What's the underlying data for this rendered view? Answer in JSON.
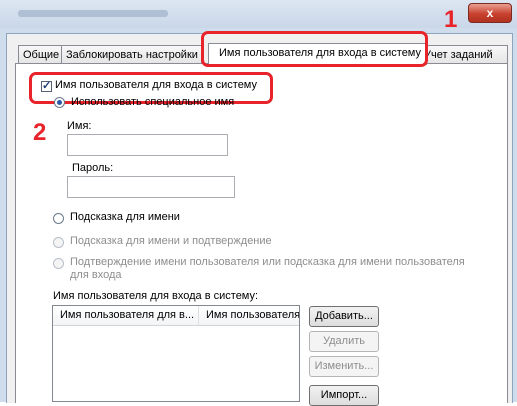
{
  "window": {
    "close_glyph": "x"
  },
  "tabs": [
    {
      "label": "Общие"
    },
    {
      "label": "Заблокировать настройки"
    },
    {
      "label": "Имя пользователя для входа в систему"
    },
    {
      "label": "Учет заданий"
    }
  ],
  "callouts": {
    "one": "1",
    "two": "2"
  },
  "login_checkbox": {
    "label": "Имя пользователя для входа в систему",
    "checked": true
  },
  "option_special_name": {
    "label": "Использовать специальное имя",
    "checked": true
  },
  "name_field": {
    "label": "Имя:",
    "value": ""
  },
  "password_field": {
    "label": "Пароль:",
    "value": ""
  },
  "option_prompt_name": {
    "label": "Подсказка для имени"
  },
  "option_prompt_name_confirm": {
    "label": "Подсказка для имени и подтверждение"
  },
  "option_confirm_or_prompt": {
    "label": "Подтверждение имени пользователя или подсказка для имени пользователя для входа"
  },
  "list_section_label": "Имя пользователя для входа в систему:",
  "list_columns": [
    "Имя пользователя для в...",
    "Имя пользователя"
  ],
  "buttons": {
    "add": "Добавить...",
    "delete": "Удалить",
    "edit": "Изменить...",
    "import": "Импорт..."
  },
  "colors": {
    "callout_red": "#e8232a",
    "close_button": "#c8412e"
  },
  "icons": {
    "close": "close-icon",
    "checkbox": "checkbox-icon",
    "radio": "radio-icon"
  }
}
